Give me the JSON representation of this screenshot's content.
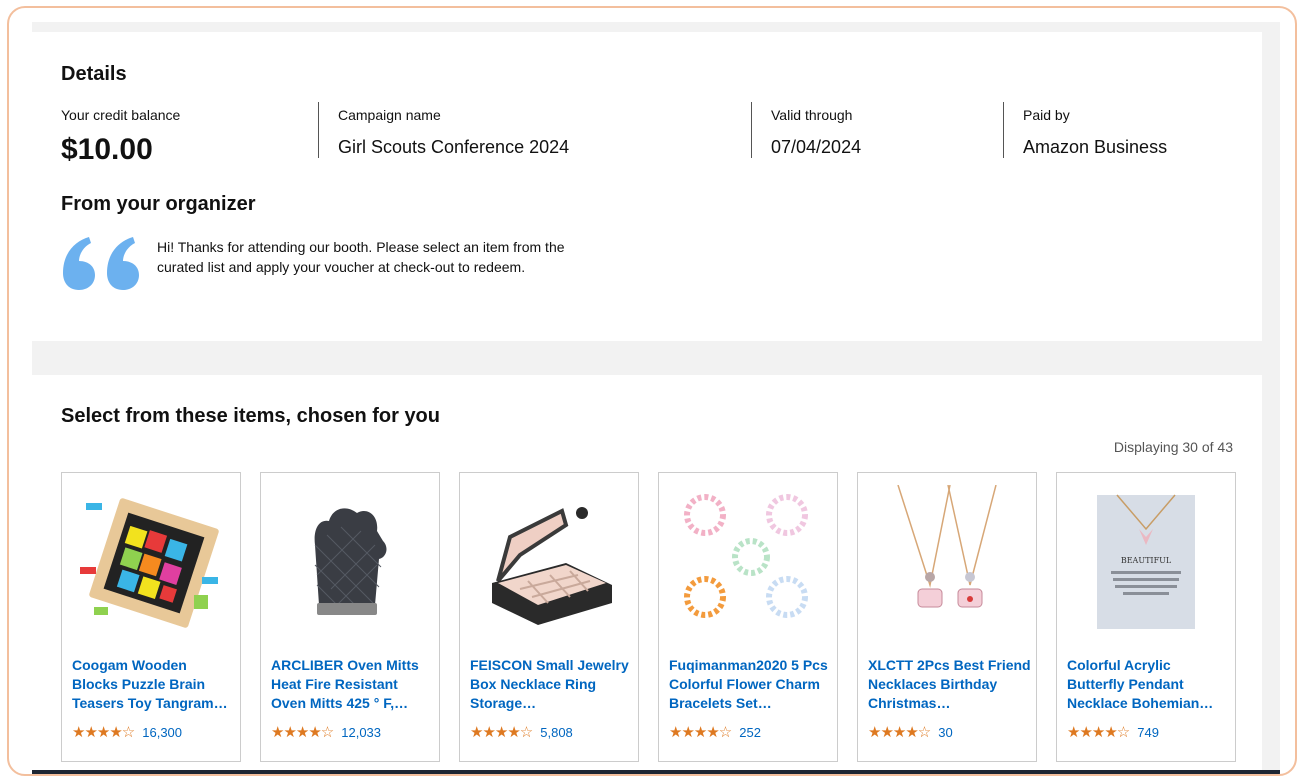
{
  "details": {
    "heading": "Details",
    "credit_label": "Your credit balance",
    "credit_value": "$10.00",
    "campaign_label": "Campaign name",
    "campaign_value": "Girl Scouts Conference 2024",
    "valid_label": "Valid through",
    "valid_value": "07/04/2024",
    "paid_label": "Paid by",
    "paid_value": "Amazon Business"
  },
  "organizer": {
    "heading": "From your organizer",
    "message": "Hi! Thanks for attending our booth. Please select an item from the curated list and apply your voucher at check-out to redeem.",
    "quote_color": "#6cb1ef"
  },
  "items": {
    "heading": "Select from these items, chosen for you",
    "displaying": "Displaying 30 of 43",
    "products": [
      {
        "title": "Coogam Wooden Blocks Puzzle Brain Teasers Toy Tangram…",
        "stars": "★★★★☆",
        "rating_value": 4.5,
        "count": "16,300",
        "image": "wooden-puzzle-image"
      },
      {
        "title": "ARCLIBER Oven Mitts Heat Fire Resistant Oven Mitts 425 ° F,…",
        "stars": "★★★★☆",
        "rating_value": 4.5,
        "count": "12,033",
        "image": "oven-mitts-image"
      },
      {
        "title": "FEISCON Small Jewelry Box Necklace Ring Storage…",
        "stars": "★★★★☆",
        "rating_value": 4.5,
        "count": "5,808",
        "image": "jewelry-box-image"
      },
      {
        "title": "Fuqimanman2020 5 Pcs Colorful Flower Charm Bracelets Set…",
        "stars": "★★★★☆",
        "rating_value": 4.5,
        "count": "252",
        "image": "bracelets-image"
      },
      {
        "title": "XLCTT 2Pcs Best Friend Necklaces Birthday Christmas…",
        "stars": "★★★★☆",
        "rating_value": 4.5,
        "count": "30",
        "image": "necklaces-image"
      },
      {
        "title": "Colorful Acrylic Butterfly Pendant Necklace Bohemian…",
        "stars": "★★★★☆",
        "rating_value": 4.5,
        "count": "749",
        "image": "butterfly-necklace-image"
      }
    ],
    "butterfly_card_text": "BEAUTIFUL"
  },
  "colors": {
    "link": "#0066c0",
    "star": "#de7921",
    "frame_border": "#f3bf9d"
  }
}
